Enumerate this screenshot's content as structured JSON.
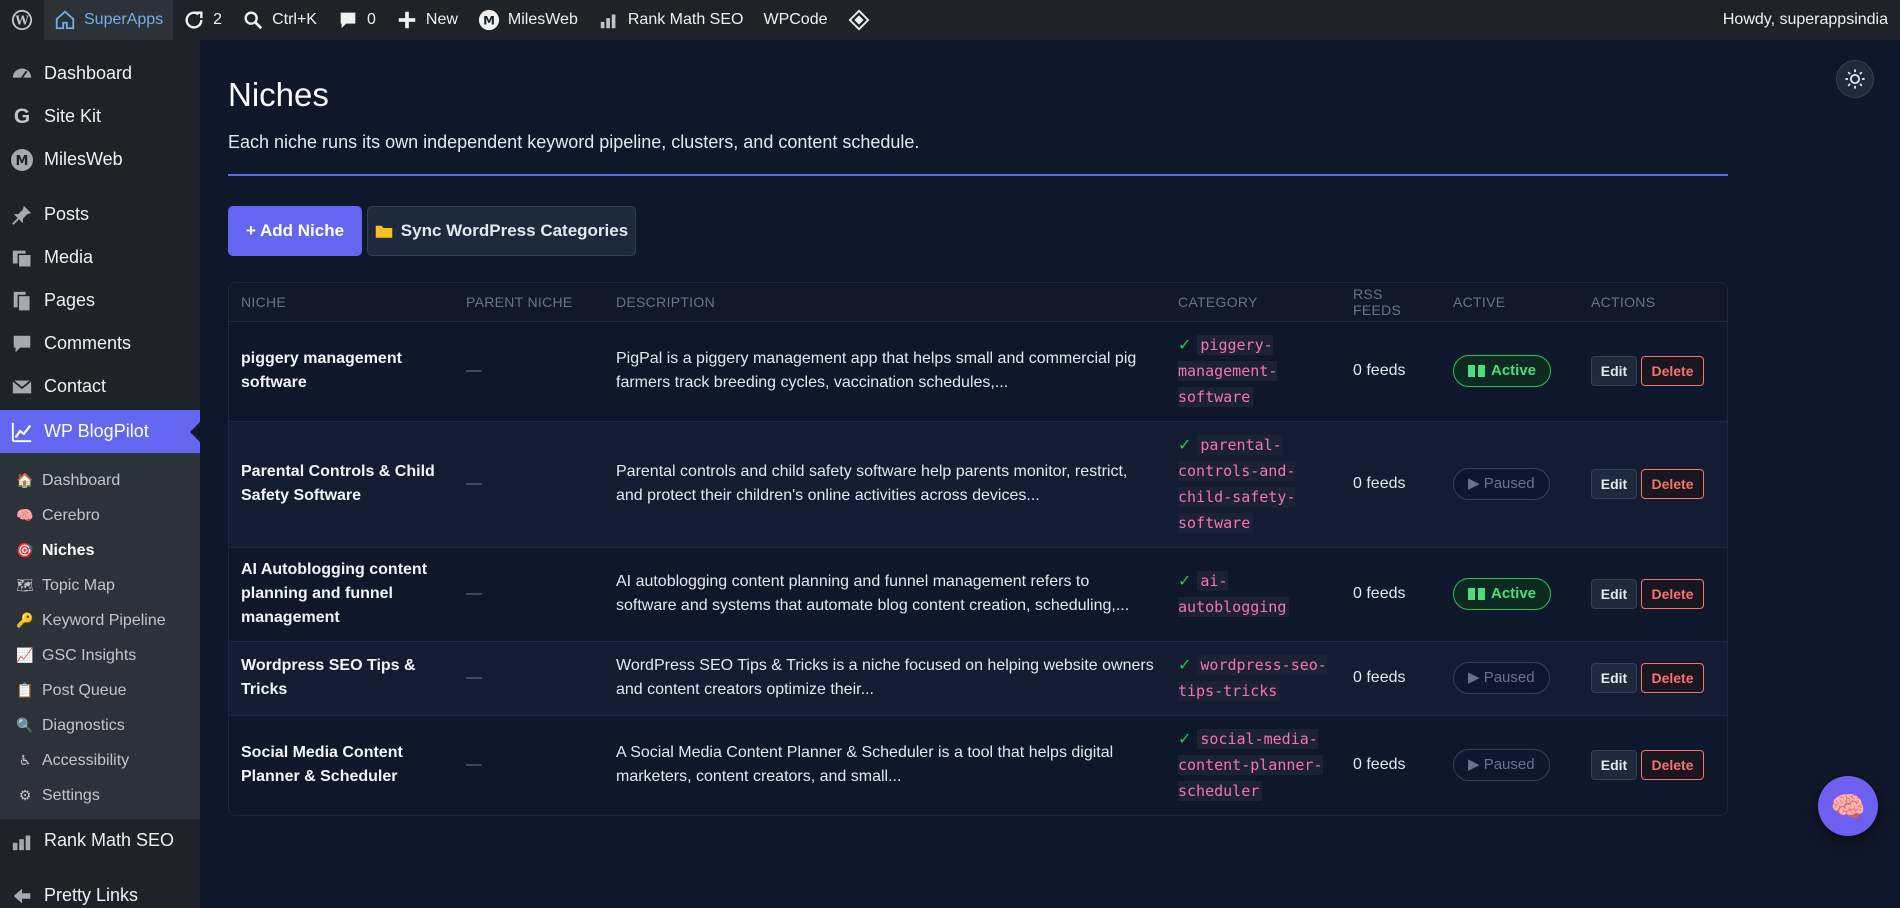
{
  "adminbar": {
    "site_name": "SuperApps",
    "updates_count": "2",
    "search_shortcut": "Ctrl+K",
    "comments_count": "0",
    "new_label": "New",
    "milesweb_label": "MilesWeb",
    "rankmath_label": "Rank Math SEO",
    "wpcode_label": "WPCode",
    "greeting": "Howdy, superappsindia"
  },
  "sidebar": {
    "top_items": [
      {
        "label": "Dashboard",
        "icon": "dashboard-icon"
      },
      {
        "label": "Site Kit",
        "icon": "google-icon"
      },
      {
        "label": "MilesWeb",
        "icon": "milesweb-icon"
      }
    ],
    "content_items": [
      {
        "label": "Posts",
        "icon": "pin-icon"
      },
      {
        "label": "Media",
        "icon": "media-icon"
      },
      {
        "label": "Pages",
        "icon": "pages-icon"
      },
      {
        "label": "Comments",
        "icon": "comment-icon"
      },
      {
        "label": "Contact",
        "icon": "mail-icon"
      }
    ],
    "active_item": {
      "label": "WP BlogPilot",
      "icon": "chart-icon"
    },
    "submenu": [
      {
        "label": "Dashboard",
        "emoji": "🏠"
      },
      {
        "label": "Cerebro",
        "emoji": "🧠"
      },
      {
        "label": "Niches",
        "emoji": "🎯"
      },
      {
        "label": "Topic Map",
        "emoji": "🗺"
      },
      {
        "label": "Keyword Pipeline",
        "emoji": "🔑"
      },
      {
        "label": "GSC Insights",
        "emoji": "📈"
      },
      {
        "label": "Post Queue",
        "emoji": "📋"
      },
      {
        "label": "Diagnostics",
        "emoji": "🔍"
      },
      {
        "label": "Accessibility",
        "emoji": "♿"
      },
      {
        "label": "Settings",
        "emoji": "⚙"
      }
    ],
    "bottom_items": [
      {
        "label": "Rank Math SEO",
        "icon": "rankmath-icon"
      },
      {
        "label": "Pretty Links",
        "icon": "link-icon"
      }
    ]
  },
  "page": {
    "title": "Niches",
    "subtitle": "Each niche runs its own independent keyword pipeline, clusters, and content schedule.",
    "add_button": "+ Add Niche",
    "sync_button": "Sync WordPress Categories",
    "accent": "#6366f1"
  },
  "table": {
    "headers": [
      "Niche",
      "Parent Niche",
      "Description",
      "Category",
      "RSS Feeds",
      "Active",
      "Actions"
    ],
    "rows": [
      {
        "name": "piggery management software",
        "parent": "—",
        "description": "PigPal is a piggery management app that helps small and commercial pig farmers track breeding cycles, vaccination schedules,...",
        "category": "piggery-management-software",
        "feeds": "0 feeds",
        "status": "Active",
        "active": true
      },
      {
        "name": "Parental Controls & Child Safety Software",
        "parent": "—",
        "description": "Parental controls and child safety software help parents monitor, restrict, and protect their children's online activities across devices...",
        "category": "parental-controls-and-child-safety-software",
        "feeds": "0 feeds",
        "status": "▶ Paused",
        "active": false
      },
      {
        "name": "AI Autoblogging content planning and funnel management",
        "parent": "—",
        "description": "AI autoblogging content planning and funnel management refers to software and systems that automate blog content creation, scheduling,...",
        "category": "ai-autoblogging",
        "feeds": "0 feeds",
        "status": "Active",
        "active": true
      },
      {
        "name": "Wordpress SEO Tips & Tricks",
        "parent": "—",
        "description": "WordPress SEO Tips & Tricks is a niche focused on helping website owners and content creators optimize their...",
        "category": "wordpress-seo-tips-tricks",
        "feeds": "0 feeds",
        "status": "▶ Paused",
        "active": false
      },
      {
        "name": "Social Media Content Planner & Scheduler",
        "parent": "—",
        "description": "A Social Media Content Planner & Scheduler is a tool that helps digital marketers, content creators, and small...",
        "category": "social-media-content-planner-scheduler",
        "feeds": "0 feeds",
        "status": "▶ Paused",
        "active": false
      }
    ],
    "edit_label": "Edit",
    "delete_label": "Delete"
  }
}
